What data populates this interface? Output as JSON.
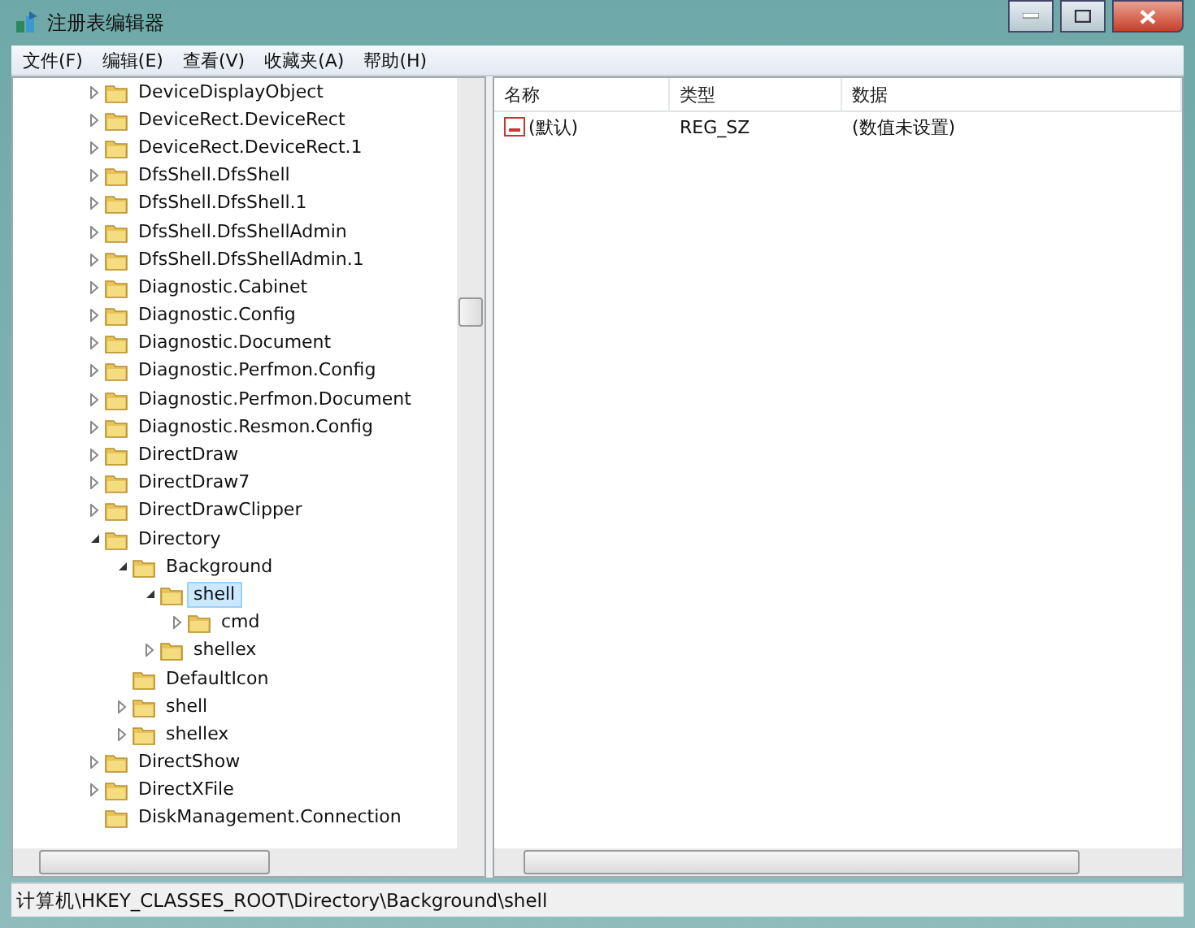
{
  "window": {
    "title": "注册表编辑器"
  },
  "menu": [
    "文件(F)",
    "编辑(E)",
    "查看(V)",
    "收藏夹(A)",
    "帮助(H)"
  ],
  "tree": [
    {
      "label": "DeviceDisplayObject",
      "expanded": false,
      "selected": false
    },
    {
      "label": "DeviceRect.DeviceRect",
      "expanded": false,
      "selected": false
    },
    {
      "label": "DeviceRect.DeviceRect.1",
      "expanded": false,
      "selected": false
    },
    {
      "label": "DfsShell.DfsShell",
      "expanded": false,
      "selected": false
    },
    {
      "label": "DfsShell.DfsShell.1",
      "expanded": false,
      "selected": false
    },
    {
      "label": "DfsShell.DfsShellAdmin",
      "expanded": false,
      "selected": false
    },
    {
      "label": "DfsShell.DfsShellAdmin.1",
      "expanded": false,
      "selected": false
    },
    {
      "label": "Diagnostic.Cabinet",
      "expanded": false,
      "selected": false
    },
    {
      "label": "Diagnostic.Config",
      "expanded": false,
      "selected": false
    },
    {
      "label": "Diagnostic.Document",
      "expanded": false,
      "selected": false
    },
    {
      "label": "Diagnostic.Perfmon.Config",
      "expanded": false,
      "selected": false
    },
    {
      "label": "Diagnostic.Perfmon.Document",
      "expanded": false,
      "selected": false
    },
    {
      "label": "Diagnostic.Resmon.Config",
      "expanded": false,
      "selected": false
    },
    {
      "label": "DirectDraw",
      "expanded": false,
      "selected": false
    },
    {
      "label": "DirectDraw7",
      "expanded": false,
      "selected": false
    },
    {
      "label": "DirectDrawClipper",
      "expanded": false,
      "selected": false
    },
    {
      "label": "Directory",
      "expanded": true,
      "selected": false,
      "children": [
        {
          "label": "Background",
          "expanded": true,
          "selected": false,
          "children": [
            {
              "label": "shell",
              "expanded": true,
              "selected": true,
              "children": [
                {
                  "label": "cmd",
                  "expanded": false,
                  "selected": false
                }
              ]
            },
            {
              "label": "shellex",
              "expanded": false,
              "selected": false
            }
          ]
        },
        {
          "label": "DefaultIcon",
          "selected": false
        },
        {
          "label": "shell",
          "expanded": false,
          "selected": false
        },
        {
          "label": "shellex",
          "expanded": false,
          "selected": false
        }
      ]
    },
    {
      "label": "DirectShow",
      "expanded": false,
      "selected": false
    },
    {
      "label": "DirectXFile",
      "expanded": false,
      "selected": false
    },
    {
      "label": "DiskManagement.Connection",
      "selected": false
    }
  ],
  "values": {
    "columns": [
      "名称",
      "类型",
      "数据"
    ],
    "rows": [
      {
        "name": "(默认)",
        "type": "REG_SZ",
        "data": "(数值未设置)"
      }
    ]
  },
  "status_bar": "计算机\\HKEY_CLASSES_ROOT\\Directory\\Background\\shell"
}
